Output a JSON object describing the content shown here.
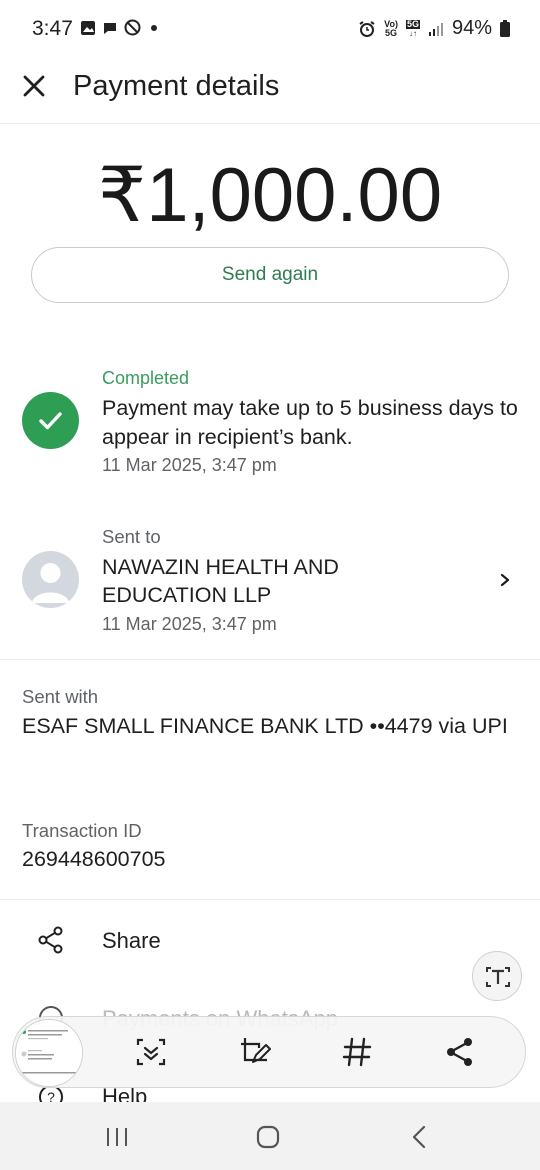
{
  "status_bar": {
    "time": "3:47",
    "battery": "94%",
    "network_top": "Vo)",
    "network_bottom": "5G",
    "signal_label": "5G",
    "left_icons": [
      "gallery-icon",
      "chat-icon",
      "block-icon",
      "dot-icon"
    ],
    "right_icons": [
      "alarm-icon",
      "volte-icon",
      "5g-icon",
      "signal-icon",
      "battery-icon"
    ]
  },
  "header": {
    "title": "Payment details",
    "close_icon": "close-icon"
  },
  "payment": {
    "amount": "₹1,000.00",
    "send_again_label": "Send again",
    "status_label": "Completed",
    "status_message": "Payment may take up to 5 business days to appear in recipient’s bank.",
    "status_date": "11 Mar 2025, 3:47 pm",
    "sent_to_label": "Sent to",
    "recipient": "NAWAZIN HEALTH AND EDUCATION LLP",
    "recipient_date": "11 Mar 2025, 3:47 pm",
    "sent_with_label": "Sent with",
    "sent_with": "ESAF SMALL FINANCE BANK LTD ••4479 via UPI",
    "transaction_label": "Transaction ID",
    "transaction_id": "269448600705"
  },
  "actions": [
    {
      "label": "Share",
      "icon": "share-icon"
    },
    {
      "label": "Payments on WhatsApp",
      "icon": "whatsapp-icon"
    },
    {
      "label": "Help",
      "icon": "help-icon"
    }
  ],
  "screenshot_toolbar": {
    "tools": [
      "smart-select-icon",
      "draw-crop-icon",
      "hashtag-icon",
      "share-icon"
    ],
    "text_extract_icon": "text-extract-icon"
  },
  "nav_bar": {
    "buttons": [
      "recents-icon",
      "home-icon",
      "back-icon"
    ]
  },
  "colors": {
    "accent_green": "#2f9e55",
    "status_green": "#3a9c5f",
    "button_text_green": "#2f7d4f",
    "secondary_text": "#5f6368"
  }
}
